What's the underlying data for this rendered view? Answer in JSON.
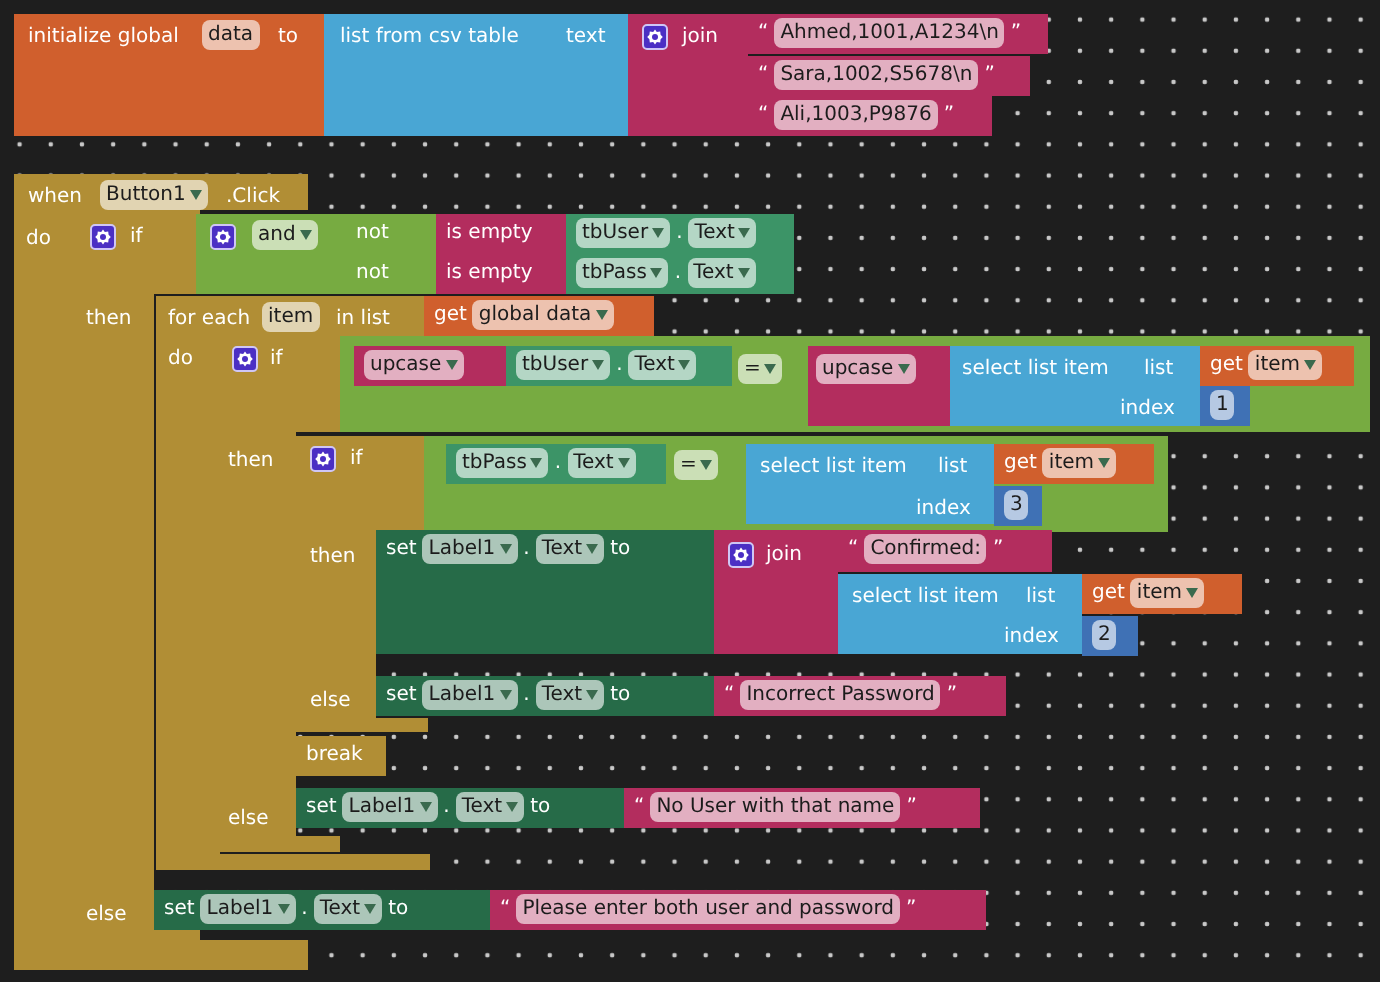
{
  "blocks": [
    {
      "kind": "variable",
      "parts": [
        {
          "kind": "label",
          "text": "initialize global"
        },
        {
          "kind": "field",
          "text": "data"
        },
        {
          "kind": "label",
          "text": "to"
        },
        {
          "kind": "input",
          "block": {
            "kind": "list",
            "parts": [
              {
                "kind": "label",
                "text": "list from csv table"
              },
              {
                "kind": "label",
                "text": "text"
              },
              {
                "kind": "input",
                "block": {
                  "kind": "text",
                  "parts": [
                    {
                      "kind": "gear"
                    },
                    {
                      "kind": "label",
                      "text": "join"
                    },
                    {
                      "kind": "input",
                      "block": {
                        "kind": "text",
                        "parts": [
                          {
                            "kind": "quote",
                            "text": "“"
                          },
                          {
                            "kind": "string",
                            "text": "Ahmed,1001,A1234\\n"
                          },
                          {
                            "kind": "quote",
                            "text": "”"
                          }
                        ]
                      }
                    },
                    {
                      "kind": "input",
                      "block": {
                        "kind": "text",
                        "parts": [
                          {
                            "kind": "quote",
                            "text": "“"
                          },
                          {
                            "kind": "string",
                            "text": "Sara,1002,S5678\\n"
                          },
                          {
                            "kind": "quote",
                            "text": "”"
                          }
                        ]
                      }
                    },
                    {
                      "kind": "input",
                      "block": {
                        "kind": "text",
                        "parts": [
                          {
                            "kind": "quote",
                            "text": "“"
                          },
                          {
                            "kind": "string",
                            "text": "Ali,1003,P9876"
                          },
                          {
                            "kind": "quote",
                            "text": "”"
                          }
                        ]
                      }
                    }
                  ]
                }
              }
            ]
          }
        }
      ]
    },
    {
      "kind": "event",
      "parts": [
        {
          "kind": "label",
          "text": "when"
        },
        {
          "kind": "dropdown",
          "text": "Button1"
        },
        {
          "kind": "label",
          "text": ".Click"
        },
        {
          "kind": "label",
          "text": "do"
        },
        {
          "kind": "input",
          "block": {
            "kind": "control",
            "parts": [
              {
                "kind": "gear"
              },
              {
                "kind": "label",
                "text": "if"
              },
              {
                "kind": "input",
                "block": {
                  "kind": "logic",
                  "parts": [
                    {
                      "kind": "gear"
                    },
                    {
                      "kind": "dropdown",
                      "text": "and"
                    },
                    {
                      "kind": "input",
                      "block": {
                        "kind": "logic",
                        "parts": [
                          {
                            "kind": "label",
                            "text": "not"
                          },
                          {
                            "kind": "input",
                            "block": {
                              "kind": "text",
                              "parts": [
                                {
                                  "kind": "label",
                                  "text": "is empty"
                                },
                                {
                                  "kind": "input",
                                  "block": {
                                    "kind": "component-get",
                                    "parts": [
                                      {
                                        "kind": "dropdown",
                                        "text": "tbUser"
                                      },
                                      {
                                        "kind": "label",
                                        "text": "."
                                      },
                                      {
                                        "kind": "dropdown",
                                        "text": "Text"
                                      }
                                    ]
                                  }
                                }
                              ]
                            }
                          }
                        ]
                      }
                    },
                    {
                      "kind": "input",
                      "block": {
                        "kind": "logic",
                        "parts": [
                          {
                            "kind": "label",
                            "text": "not"
                          },
                          {
                            "kind": "input",
                            "block": {
                              "kind": "text",
                              "parts": [
                                {
                                  "kind": "label",
                                  "text": "is empty"
                                },
                                {
                                  "kind": "input",
                                  "block": {
                                    "kind": "component-get",
                                    "parts": [
                                      {
                                        "kind": "dropdown",
                                        "text": "tbPass"
                                      },
                                      {
                                        "kind": "label",
                                        "text": "."
                                      },
                                      {
                                        "kind": "dropdown",
                                        "text": "Text"
                                      }
                                    ]
                                  }
                                }
                              ]
                            }
                          }
                        ]
                      }
                    }
                  ]
                }
              },
              {
                "kind": "label",
                "text": "then"
              },
              {
                "kind": "input",
                "block": {
                  "kind": "control",
                  "parts": [
                    {
                      "kind": "label",
                      "text": "for each"
                    },
                    {
                      "kind": "field",
                      "text": "item"
                    },
                    {
                      "kind": "label",
                      "text": "in list"
                    },
                    {
                      "kind": "input",
                      "block": {
                        "kind": "variable",
                        "parts": [
                          {
                            "kind": "label",
                            "text": "get"
                          },
                          {
                            "kind": "dropdown",
                            "text": "global data"
                          }
                        ]
                      }
                    },
                    {
                      "kind": "label",
                      "text": "do"
                    },
                    {
                      "kind": "input",
                      "block": {
                        "kind": "control",
                        "parts": [
                          {
                            "kind": "gear"
                          },
                          {
                            "kind": "label",
                            "text": "if"
                          },
                          {
                            "kind": "input",
                            "block": {
                              "kind": "logic",
                              "parts": [
                                {
                                  "kind": "input",
                                  "block": {
                                    "kind": "text",
                                    "parts": [
                                      {
                                        "kind": "dropdown",
                                        "text": "upcase"
                                      },
                                      {
                                        "kind": "input",
                                        "block": {
                                          "kind": "component-get",
                                          "parts": [
                                            {
                                              "kind": "dropdown",
                                              "text": "tbUser"
                                            },
                                            {
                                              "kind": "label",
                                              "text": "."
                                            },
                                            {
                                              "kind": "dropdown",
                                              "text": "Text"
                                            }
                                          ]
                                        }
                                      }
                                    ]
                                  }
                                },
                                {
                                  "kind": "dropdown",
                                  "text": "="
                                },
                                {
                                  "kind": "input",
                                  "block": {
                                    "kind": "text",
                                    "parts": [
                                      {
                                        "kind": "dropdown",
                                        "text": "upcase"
                                      },
                                      {
                                        "kind": "input",
                                        "block": {
                                          "kind": "list",
                                          "parts": [
                                            {
                                              "kind": "label",
                                              "text": "select list item"
                                            },
                                            {
                                              "kind": "label",
                                              "text": "list"
                                            },
                                            {
                                              "kind": "input",
                                              "block": {
                                                "kind": "variable",
                                                "parts": [
                                                  {
                                                    "kind": "label",
                                                    "text": "get"
                                                  },
                                                  {
                                                    "kind": "dropdown",
                                                    "text": "item"
                                                  }
                                                ]
                                              }
                                            },
                                            {
                                              "kind": "label",
                                              "text": "index"
                                            },
                                            {
                                              "kind": "input",
                                              "block": {
                                                "kind": "math",
                                                "parts": [
                                                  {
                                                    "kind": "number",
                                                    "text": "1"
                                                  }
                                                ]
                                              }
                                            }
                                          ]
                                        }
                                      }
                                    ]
                                  }
                                }
                              ]
                            }
                          },
                          {
                            "kind": "label",
                            "text": "then"
                          },
                          {
                            "kind": "input",
                            "block": {
                              "kind": "control",
                              "parts": [
                                {
                                  "kind": "gear"
                                },
                                {
                                  "kind": "label",
                                  "text": "if"
                                },
                                {
                                  "kind": "input",
                                  "block": {
                                    "kind": "logic",
                                    "parts": [
                                      {
                                        "kind": "input",
                                        "block": {
                                          "kind": "component-get",
                                          "parts": [
                                            {
                                              "kind": "dropdown",
                                              "text": "tbPass"
                                            },
                                            {
                                              "kind": "label",
                                              "text": "."
                                            },
                                            {
                                              "kind": "dropdown",
                                              "text": "Text"
                                            }
                                          ]
                                        }
                                      },
                                      {
                                        "kind": "dropdown",
                                        "text": "="
                                      },
                                      {
                                        "kind": "input",
                                        "block": {
                                          "kind": "list",
                                          "parts": [
                                            {
                                              "kind": "label",
                                              "text": "select list item"
                                            },
                                            {
                                              "kind": "label",
                                              "text": "list"
                                            },
                                            {
                                              "kind": "input",
                                              "block": {
                                                "kind": "variable",
                                                "parts": [
                                                  {
                                                    "kind": "label",
                                                    "text": "get"
                                                  },
                                                  {
                                                    "kind": "dropdown",
                                                    "text": "item"
                                                  }
                                                ]
                                              }
                                            },
                                            {
                                              "kind": "label",
                                              "text": "index"
                                            },
                                            {
                                              "kind": "input",
                                              "block": {
                                                "kind": "math",
                                                "parts": [
                                                  {
                                                    "kind": "number",
                                                    "text": "3"
                                                  }
                                                ]
                                              }
                                            }
                                          ]
                                        }
                                      }
                                    ]
                                  }
                                },
                                {
                                  "kind": "label",
                                  "text": "then"
                                },
                                {
                                  "kind": "input",
                                  "block": {
                                    "kind": "component-set",
                                    "parts": [
                                      {
                                        "kind": "label",
                                        "text": "set"
                                      },
                                      {
                                        "kind": "dropdown",
                                        "text": "Label1"
                                      },
                                      {
                                        "kind": "label",
                                        "text": "."
                                      },
                                      {
                                        "kind": "dropdown",
                                        "text": "Text"
                                      },
                                      {
                                        "kind": "label",
                                        "text": "to"
                                      },
                                      {
                                        "kind": "input",
                                        "block": {
                                          "kind": "text",
                                          "parts": [
                                            {
                                              "kind": "gear"
                                            },
                                            {
                                              "kind": "label",
                                              "text": "join"
                                            },
                                            {
                                              "kind": "input",
                                              "block": {
                                                "kind": "text",
                                                "parts": [
                                                  {
                                                    "kind": "quote",
                                                    "text": "“"
                                                  },
                                                  {
                                                    "kind": "string",
                                                    "text": "Confirmed: "
                                                  },
                                                  {
                                                    "kind": "quote",
                                                    "text": "”"
                                                  }
                                                ]
                                              }
                                            },
                                            {
                                              "kind": "input",
                                              "block": {
                                                "kind": "list",
                                                "parts": [
                                                  {
                                                    "kind": "label",
                                                    "text": "select list item"
                                                  },
                                                  {
                                                    "kind": "label",
                                                    "text": "list"
                                                  },
                                                  {
                                                    "kind": "input",
                                                    "block": {
                                                      "kind": "variable",
                                                      "parts": [
                                                        {
                                                          "kind": "label",
                                                          "text": "get"
                                                        },
                                                        {
                                                          "kind": "dropdown",
                                                          "text": "item"
                                                        }
                                                      ]
                                                    }
                                                  },
                                                  {
                                                    "kind": "label",
                                                    "text": "index"
                                                  },
                                                  {
                                                    "kind": "input",
                                                    "block": {
                                                      "kind": "math",
                                                      "parts": [
                                                        {
                                                          "kind": "number",
                                                          "text": "2"
                                                        }
                                                      ]
                                                    }
                                                  }
                                                ]
                                              }
                                            }
                                          ]
                                        }
                                      }
                                    ]
                                  }
                                },
                                {
                                  "kind": "label",
                                  "text": "else"
                                },
                                {
                                  "kind": "input",
                                  "block": {
                                    "kind": "component-set",
                                    "parts": [
                                      {
                                        "kind": "label",
                                        "text": "set"
                                      },
                                      {
                                        "kind": "dropdown",
                                        "text": "Label1"
                                      },
                                      {
                                        "kind": "label",
                                        "text": "."
                                      },
                                      {
                                        "kind": "dropdown",
                                        "text": "Text"
                                      },
                                      {
                                        "kind": "label",
                                        "text": "to"
                                      },
                                      {
                                        "kind": "input",
                                        "block": {
                                          "kind": "text",
                                          "parts": [
                                            {
                                              "kind": "quote",
                                              "text": "“"
                                            },
                                            {
                                              "kind": "string",
                                              "text": "Incorrect Password"
                                            },
                                            {
                                              "kind": "quote",
                                              "text": "”"
                                            }
                                          ]
                                        }
                                      }
                                    ]
                                  }
                                }
                              ]
                            }
                          },
                          {
                            "kind": "input",
                            "block": {
                              "kind": "control",
                              "parts": [
                                {
                                  "kind": "label",
                                  "text": "break"
                                }
                              ]
                            }
                          },
                          {
                            "kind": "label",
                            "text": "else"
                          },
                          {
                            "kind": "input",
                            "block": {
                              "kind": "component-set",
                              "parts": [
                                {
                                  "kind": "label",
                                  "text": "set"
                                },
                                {
                                  "kind": "dropdown",
                                  "text": "Label1"
                                },
                                {
                                  "kind": "label",
                                  "text": "."
                                },
                                {
                                  "kind": "dropdown",
                                  "text": "Text"
                                },
                                {
                                  "kind": "label",
                                  "text": "to"
                                },
                                {
                                  "kind": "input",
                                  "block": {
                                    "kind": "text",
                                    "parts": [
                                      {
                                        "kind": "quote",
                                        "text": "“"
                                      },
                                      {
                                        "kind": "string",
                                        "text": "No User with that name"
                                      },
                                      {
                                        "kind": "quote",
                                        "text": "”"
                                      }
                                    ]
                                  }
                                }
                              ]
                            }
                          }
                        ]
                      }
                    }
                  ]
                }
              },
              {
                "kind": "label",
                "text": "else"
              },
              {
                "kind": "input",
                "block": {
                  "kind": "component-set",
                  "parts": [
                    {
                      "kind": "label",
                      "text": "set"
                    },
                    {
                      "kind": "dropdown",
                      "text": "Label1"
                    },
                    {
                      "kind": "label",
                      "text": "."
                    },
                    {
                      "kind": "dropdown",
                      "text": "Text"
                    },
                    {
                      "kind": "label",
                      "text": "to"
                    },
                    {
                      "kind": "input",
                      "block": {
                        "kind": "text",
                        "parts": [
                          {
                            "kind": "quote",
                            "text": "“"
                          },
                          {
                            "kind": "string",
                            "text": "Please enter both user and password"
                          },
                          {
                            "kind": "quote",
                            "text": "”"
                          }
                        ]
                      }
                    }
                  ]
                }
              }
            ]
          }
        }
      ]
    }
  ]
}
